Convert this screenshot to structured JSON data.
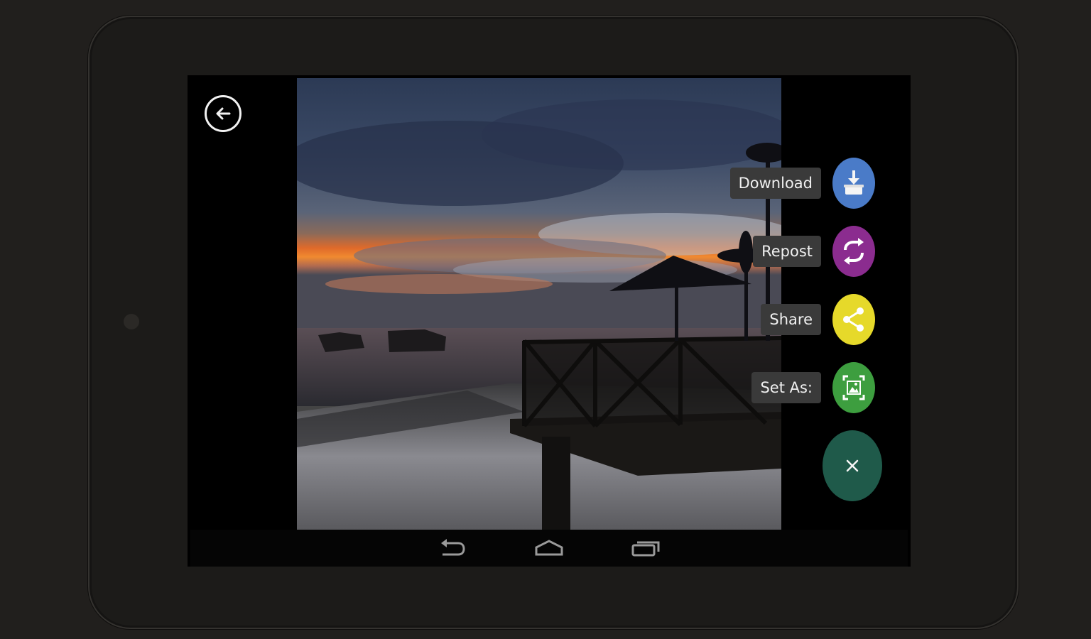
{
  "actions": {
    "download_label": "Download",
    "repost_label": "Repost",
    "share_label": "Share",
    "set_as_label": "Set As:",
    "close_icon": "close-icon"
  },
  "colors": {
    "download": "#4a7bc8",
    "repost": "#8b2c8f",
    "share": "#e6d92a",
    "set_as": "#3d9e3f",
    "close": "#1f5a4a"
  },
  "navigation": {
    "back_icon": "back-arrow-icon",
    "system_nav": [
      "back-icon",
      "home-icon",
      "recent-apps-icon"
    ]
  }
}
